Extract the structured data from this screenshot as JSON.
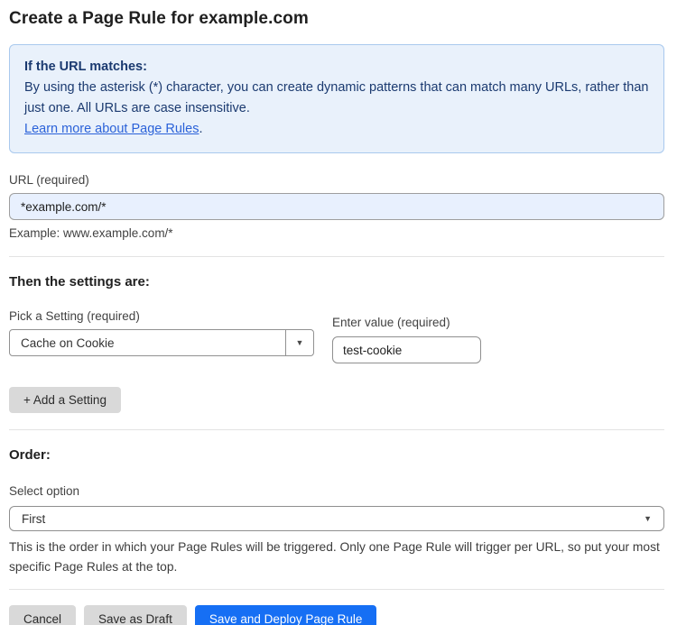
{
  "page": {
    "title": "Create a Page Rule for example.com"
  },
  "info_box": {
    "heading": "If the URL matches:",
    "body": "By using the asterisk (*) character, you can create dynamic patterns that can match many URLs, rather than just one. All URLs are case insensitive.",
    "link_label": "Learn more about Page Rules",
    "link_suffix": "."
  },
  "url_field": {
    "label": "URL (required)",
    "value": "*example.com/*",
    "example": "Example: www.example.com/*"
  },
  "settings": {
    "heading": "Then the settings are:",
    "setting_label": "Pick a Setting (required)",
    "setting_value": "Cache on Cookie",
    "value_label": "Enter value (required)",
    "value": "test-cookie",
    "add_button_label": "+ Add a Setting"
  },
  "order": {
    "heading": "Order:",
    "select_label": "Select option",
    "selected_option": "First",
    "helper": "This is the order in which your Page Rules will be triggered. Only one Page Rule will trigger per URL, so put your most specific Page Rules at the top."
  },
  "footer": {
    "cancel_label": "Cancel",
    "save_draft_label": "Save as Draft",
    "save_deploy_label": "Save and Deploy Page Rule"
  },
  "icons": {
    "dropdown_arrow": "▼"
  },
  "colors": {
    "accent_blue": "#166ff4",
    "info_background": "#e9f1fb",
    "info_border": "#a9c9ee",
    "info_text": "#1b3a70",
    "link_blue": "#2b62d9",
    "url_input_background": "#e8f0fe",
    "button_gray": "#d9d9d9"
  }
}
